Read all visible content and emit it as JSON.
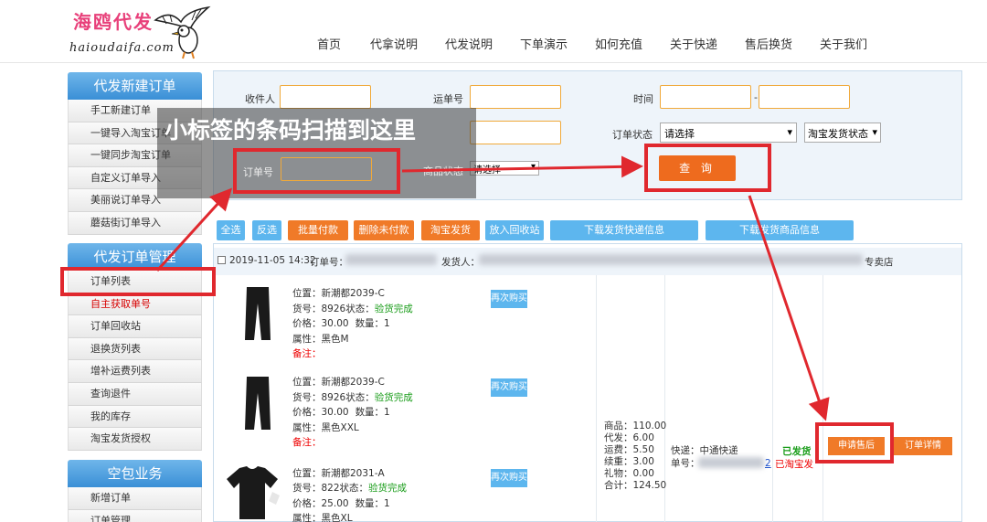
{
  "brand": {
    "name": "海鸥代发",
    "url": "haioudaifa.com"
  },
  "nav": [
    "首页",
    "代拿说明",
    "代发说明",
    "下单演示",
    "如何充值",
    "关于快递",
    "售后换货",
    "关于我们"
  ],
  "sidebar": {
    "sections": [
      {
        "title": "代发新建订单",
        "items": [
          "手工新建订单",
          "一键导入淘宝订单",
          "一键同步淘宝订单",
          "自定义订单导入",
          "美丽说订单导入",
          "蘑菇街订单导入"
        ]
      },
      {
        "title": "代发订单管理",
        "items": [
          "订单列表",
          "自主获取单号",
          "订单回收站",
          "退换货列表",
          "增补运费列表",
          "查询退件",
          "我的库存",
          "淘宝发货授权"
        ]
      },
      {
        "title": "空包业务",
        "items": [
          "新增订单",
          "订单管理"
        ]
      }
    ]
  },
  "search": {
    "recipient_label": "收件人",
    "waybill_label": "运单号",
    "time_label": "时间",
    "time_sep": "-",
    "order_status_label": "订单状态",
    "order_status_value": "请选择",
    "taobao_ship_status": "淘宝发货状态",
    "order_no_label": "订单号",
    "product_status_label": "商品状态",
    "product_status_value": "请选择",
    "query_button": "查 询"
  },
  "overlay_note": "小标签的条码扫描到这里",
  "toolbar": {
    "buttons": [
      {
        "label": "全选",
        "color": "#5db6ee"
      },
      {
        "label": "反选",
        "color": "#5db6ee"
      },
      {
        "label": "批量付款",
        "color": "#f07a28"
      },
      {
        "label": "删除未付款",
        "color": "#f07a28"
      },
      {
        "label": "淘宝发货",
        "color": "#f07a28"
      },
      {
        "label": "放入回收站",
        "color": "#5db6ee"
      },
      {
        "label": "下载发货快递信息",
        "color": "#5db6ee"
      },
      {
        "label": "下载发货商品信息",
        "color": "#5db6ee"
      }
    ]
  },
  "order": {
    "date": "2019-11-05 14:32",
    "order_no_label": "订单号：",
    "sender_label": "发货人：",
    "shop_suffix": "专卖店",
    "items": [
      {
        "position": "位置：新潮都2039-C",
        "sku": "货号：8926",
        "status_label": "状态：",
        "status": "验货完成",
        "price": "价格：30.00",
        "qty": "数量：1",
        "attr": "属性：黑色M",
        "note": "备注：",
        "rebuy": "再次购买"
      },
      {
        "position": "位置：新潮都2039-C",
        "sku": "货号：8926",
        "status_label": "状态：",
        "status": "验货完成",
        "price": "价格：30.00",
        "qty": "数量：1",
        "attr": "属性：黑色XXL",
        "note": "备注：",
        "rebuy": "再次购买"
      },
      {
        "position": "位置：新潮都2031-A",
        "sku": "货号：822",
        "status_label": "状态：",
        "status": "验货完成",
        "price": "价格：25.00",
        "qty": "数量：1",
        "attr": "属性：黑色XL",
        "note": "",
        "rebuy": "再次购买"
      }
    ],
    "fees": [
      "商品：110.00",
      "代发：6.00",
      "运费：5.50",
      "续重：3.00",
      "礼物：0.00",
      "合计：124.50"
    ],
    "express": "快递：中通快递",
    "waybill": "单号：",
    "waybill_tail": "2",
    "shipped": "已发货",
    "taobao_shipped": "已淘宝发",
    "aftersale_button": "申请售后",
    "detail_button": "订单详情"
  }
}
